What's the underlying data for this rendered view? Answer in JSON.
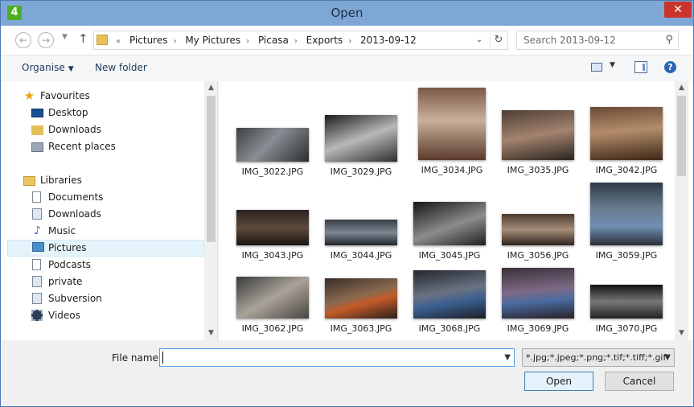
{
  "window": {
    "title": "Open",
    "app_icon_text": "4",
    "close_glyph": "✕"
  },
  "nav": {
    "back_glyph": "←",
    "forward_glyph": "→",
    "dropdown_glyph": "▼",
    "up_glyph": "↑"
  },
  "address": {
    "overflow": "«",
    "crumbs": [
      "Pictures",
      "My Pictures",
      "Picasa",
      "Exports",
      "2013-09-12"
    ],
    "separator": "›",
    "dropdown_glyph": "⌄",
    "refresh_glyph": "↻"
  },
  "search": {
    "placeholder": "Search 2013-09-12",
    "icon_glyph": "⚲"
  },
  "toolbar": {
    "organise": "Organise",
    "new_folder": "New folder",
    "caret": "▼",
    "help": "?"
  },
  "sidebar": {
    "favourites": {
      "label": "Favourites",
      "items": [
        "Desktop",
        "Downloads",
        "Recent places"
      ]
    },
    "libraries": {
      "label": "Libraries",
      "items": [
        "Documents",
        "Downloads",
        "Music",
        "Pictures",
        "Podcasts",
        "private",
        "Subversion",
        "Videos"
      ]
    },
    "selected": "Pictures"
  },
  "files": [
    {
      "name": "IMG_3022.JPG"
    },
    {
      "name": "IMG_3029.JPG"
    },
    {
      "name": "IMG_3034.JPG"
    },
    {
      "name": "IMG_3035.JPG"
    },
    {
      "name": "IMG_3042.JPG"
    },
    {
      "name": "IMG_3043.JPG"
    },
    {
      "name": "IMG_3044.JPG"
    },
    {
      "name": "IMG_3045.JPG"
    },
    {
      "name": "IMG_3056.JPG"
    },
    {
      "name": "IMG_3059.JPG"
    },
    {
      "name": "IMG_3062.JPG"
    },
    {
      "name": "IMG_3063.JPG"
    },
    {
      "name": "IMG_3068.JPG"
    },
    {
      "name": "IMG_3069.JPG"
    },
    {
      "name": "IMG_3070.JPG"
    }
  ],
  "bottom": {
    "file_name_label": "File name:",
    "file_name_value": "",
    "filter": "*.jpg;*.jpeg;*.png;*.tif;*.tiff;*.gif",
    "open": "Open",
    "cancel": "Cancel"
  }
}
